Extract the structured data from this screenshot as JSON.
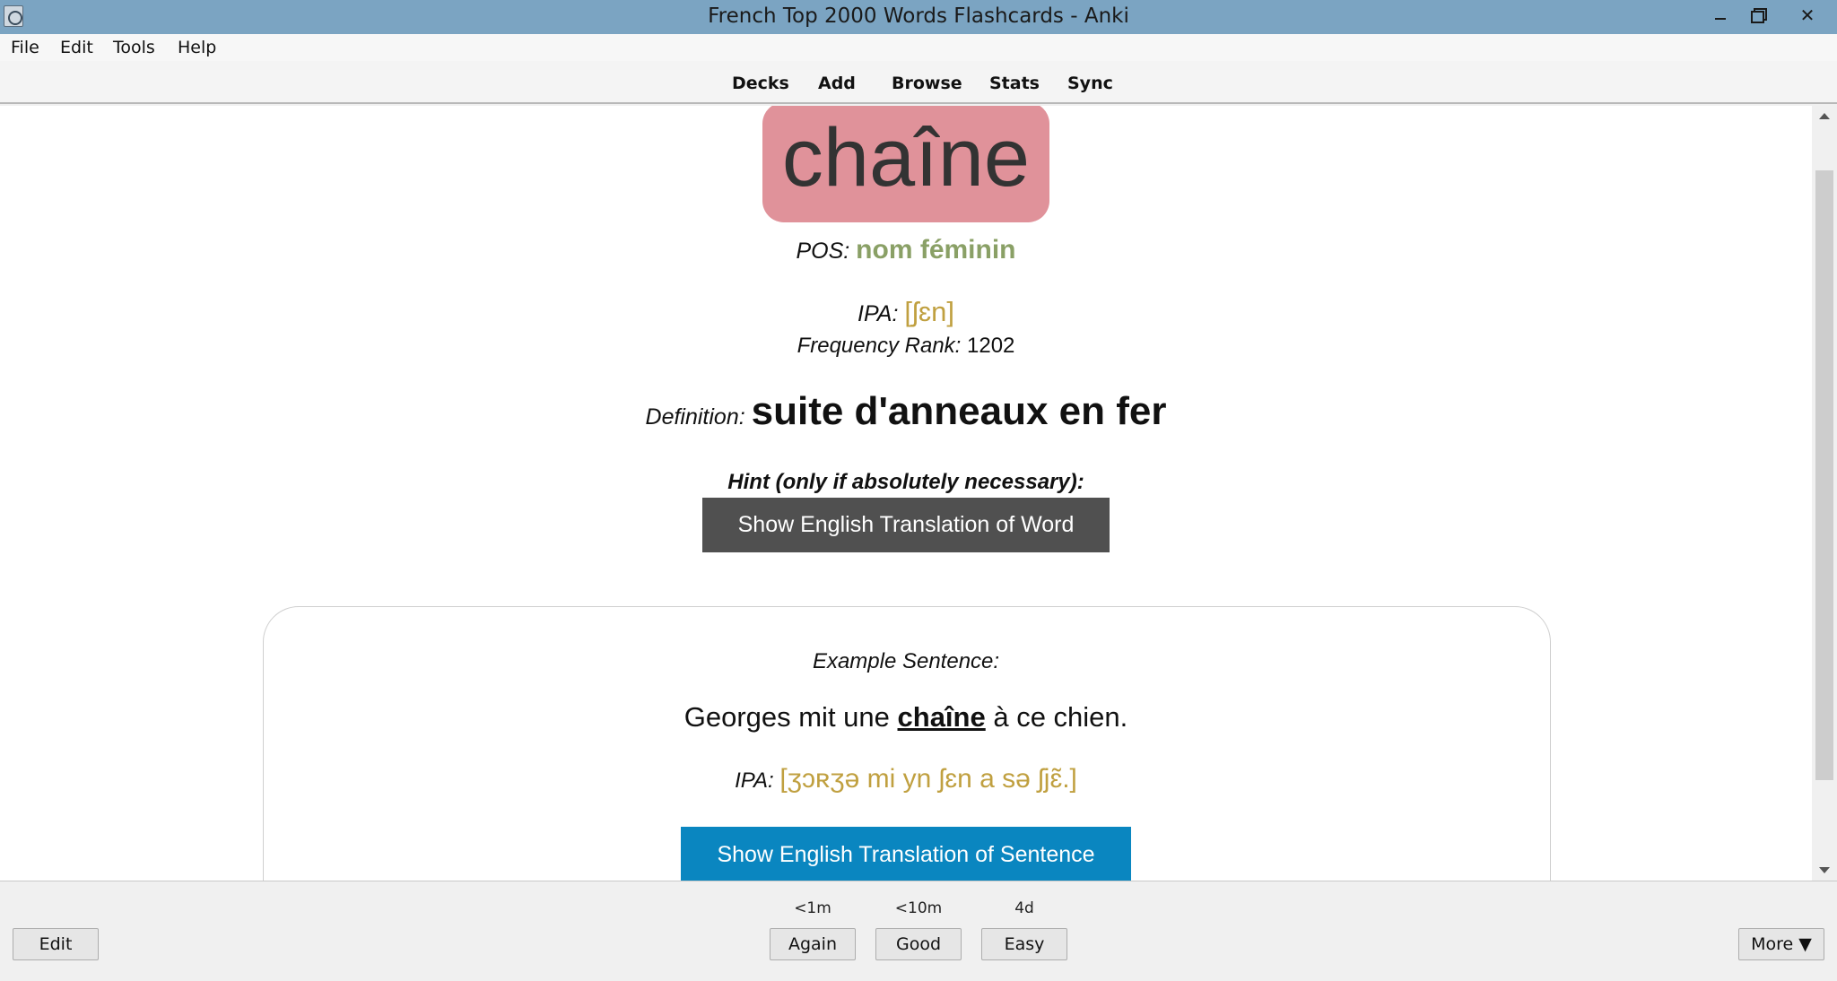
{
  "window": {
    "title": "French Top 2000 Words Flashcards - Anki"
  },
  "menu": {
    "items": [
      "File",
      "Edit",
      "Tools",
      "Help"
    ]
  },
  "toolbar": {
    "links": [
      "Decks",
      "Add",
      "Browse",
      "Stats",
      "Sync"
    ]
  },
  "card": {
    "word": "chaîne",
    "pos_label": "POS:",
    "pos_value": "nom féminin",
    "ipa_label": "IPA:",
    "ipa_value": "[ʃɛn]",
    "freq_label": "Frequency Rank:",
    "freq_value": "1202",
    "def_label": "Definition:",
    "def_value": "suite d'anneaux en fer",
    "hint_label": "Hint (only if absolutely necessary):",
    "show_word_translation": "Show English Translation of Word",
    "example_label": "Example Sentence:",
    "sentence_before": "Georges mit une ",
    "sentence_word": "chaîne",
    "sentence_after": " à ce chien.",
    "sentence_ipa_label": "IPA:",
    "sentence_ipa_value": "[ʒɔʀʒə mi yn ʃɛn a sə ʃjɛ̃.]",
    "show_sentence_translation": "Show English Translation of Sentence"
  },
  "bottom": {
    "edit_label": "Edit",
    "more_label": "More ▼",
    "answers": [
      {
        "interval": "<1m",
        "label": "Again"
      },
      {
        "interval": "<10m",
        "label": "Good"
      },
      {
        "interval": "4d",
        "label": "Easy"
      }
    ]
  },
  "colors": {
    "titlebar": "#7ba4c2",
    "word_box": "#e0929a",
    "pos_green": "#8aa066",
    "ipa_gold": "#c0a040",
    "word_button": "#505050",
    "sentence_button": "#0a86c0"
  }
}
